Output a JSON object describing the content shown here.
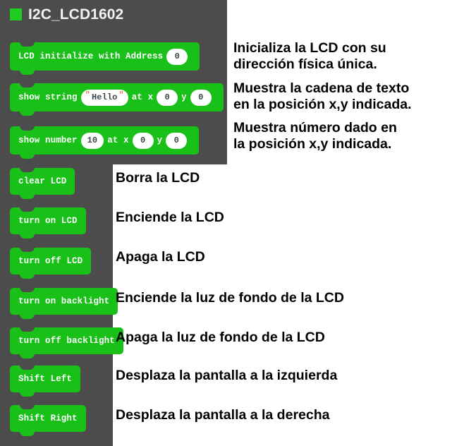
{
  "header": {
    "title": "I2C_LCD1602",
    "swatch_color": "#1fcc1f"
  },
  "theme": {
    "panel_bg": "#4c4c4c",
    "block_green": "#18c018",
    "field_bg": "#ffffff",
    "field_text": "#37474f",
    "quote_color": "#f0744c",
    "page_bg": "#ffffff",
    "anno_text": "#000000"
  },
  "blocks": [
    {
      "id": "lcd-initialize",
      "label": "LCD initialize with Address",
      "fields": [
        {
          "type": "number",
          "value": "0"
        }
      ]
    },
    {
      "id": "show-string",
      "label": "show string",
      "label2": "at x",
      "label3": "y",
      "fields": [
        {
          "type": "text",
          "value": "Hello",
          "quote": "\""
        },
        {
          "type": "number",
          "value": "0"
        },
        {
          "type": "number",
          "value": "0"
        }
      ]
    },
    {
      "id": "show-number",
      "label": "show number",
      "label2": "at x",
      "label3": "y",
      "fields": [
        {
          "type": "number",
          "value": "10"
        },
        {
          "type": "number",
          "value": "0"
        },
        {
          "type": "number",
          "value": "0"
        }
      ]
    },
    {
      "id": "clear-lcd",
      "label": "clear LCD",
      "fields": []
    },
    {
      "id": "turn-on-lcd",
      "label": "turn on LCD",
      "fields": []
    },
    {
      "id": "turn-off-lcd",
      "label": "turn off LCD",
      "fields": []
    },
    {
      "id": "turn-on-backlight",
      "label": "turn on backlight",
      "fields": []
    },
    {
      "id": "turn-off-backlight",
      "label": "turn off backlight",
      "fields": []
    },
    {
      "id": "shift-left",
      "label": "Shift Left",
      "fields": []
    },
    {
      "id": "shift-right",
      "label": "Shift Right",
      "fields": []
    }
  ],
  "annotations": [
    {
      "id": "anno-initialize",
      "text": "Inicializa la LCD con su\ndirección física única."
    },
    {
      "id": "anno-show-string",
      "text": "Muestra la cadena de texto\nen la posición x,y indicada."
    },
    {
      "id": "anno-show-number",
      "text": "Muestra número dado en\nla posición x,y indicada."
    },
    {
      "id": "anno-clear-lcd",
      "text": "Borra la LCD"
    },
    {
      "id": "anno-turn-on-lcd",
      "text": "Enciende la LCD"
    },
    {
      "id": "anno-turn-off-lcd",
      "text": "Apaga la LCD"
    },
    {
      "id": "anno-turn-on-backlight",
      "text": "Enciende la luz de fondo de la LCD"
    },
    {
      "id": "anno-turn-off-backlight",
      "text": "Apaga la luz de fondo de la LCD"
    },
    {
      "id": "anno-shift-left",
      "text": "Desplaza la pantalla a la izquierda"
    },
    {
      "id": "anno-shift-right",
      "text": "Desplaza la pantalla a la derecha"
    }
  ]
}
